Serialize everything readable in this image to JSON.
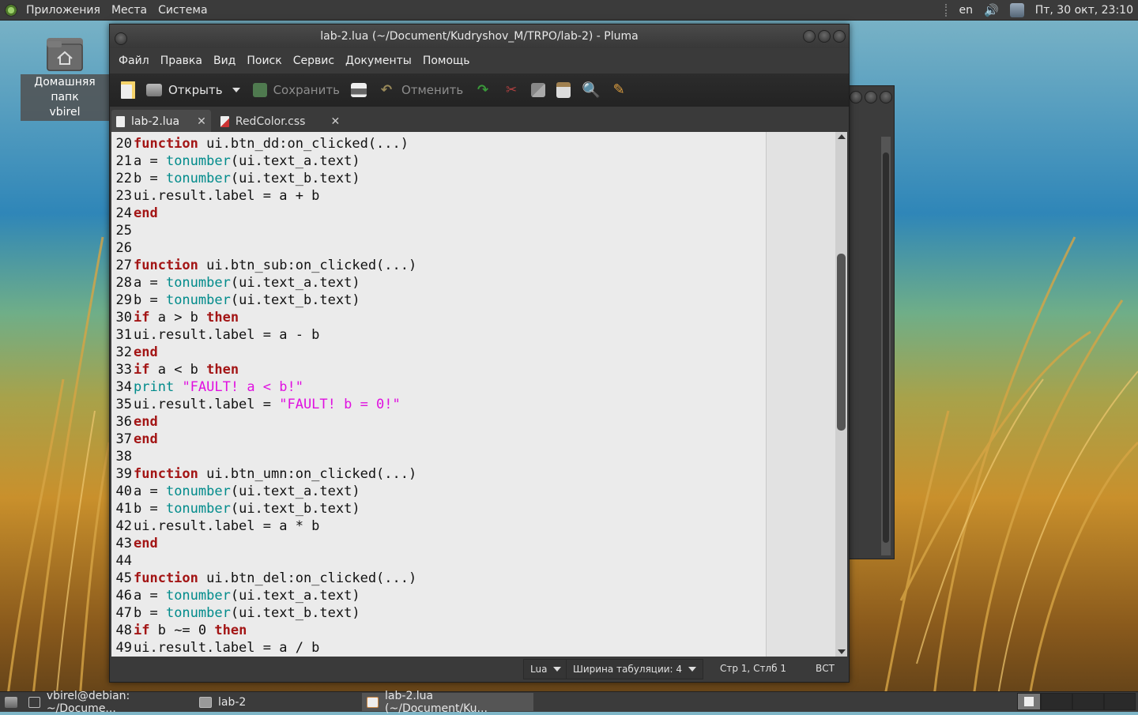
{
  "top_panel": {
    "menus": [
      "Приложения",
      "Места",
      "Система"
    ],
    "keyboard_layout": "en",
    "datetime": "Пт, 30 окт, 23:10"
  },
  "desktop": {
    "home_icon": {
      "line1": "Домашняя папк",
      "line2": "vbirel"
    }
  },
  "window": {
    "title": "lab-2.lua (~/Document/Kudryshov_M/TRPO/lab-2) - Pluma",
    "menu": [
      "Файл",
      "Правка",
      "Вид",
      "Поиск",
      "Сервис",
      "Документы",
      "Помощь"
    ],
    "toolbar": {
      "open": "Открыть",
      "save": "Сохранить",
      "undo": "Отменить"
    },
    "tabs": [
      {
        "label": "lab-2.lua",
        "active": true
      },
      {
        "label": "RedColor.css",
        "active": false
      }
    ],
    "code_lines": [
      {
        "n": "20",
        "tokens": [
          {
            "t": "function",
            "c": "kw"
          },
          {
            "t": " ui.btn_dd:on_clicked(...)",
            "c": ""
          }
        ]
      },
      {
        "n": "21",
        "tokens": [
          {
            "t": "a = ",
            "c": ""
          },
          {
            "t": "tonumber",
            "c": "fn"
          },
          {
            "t": "(ui.text_a.text)",
            "c": ""
          }
        ]
      },
      {
        "n": "22",
        "tokens": [
          {
            "t": "b = ",
            "c": ""
          },
          {
            "t": "tonumber",
            "c": "fn"
          },
          {
            "t": "(ui.text_b.text)",
            "c": ""
          }
        ]
      },
      {
        "n": "23",
        "tokens": [
          {
            "t": "ui.result.label = a + b",
            "c": ""
          }
        ]
      },
      {
        "n": "24",
        "tokens": [
          {
            "t": "end",
            "c": "kw"
          }
        ]
      },
      {
        "n": "25",
        "tokens": []
      },
      {
        "n": "26",
        "tokens": []
      },
      {
        "n": "27",
        "tokens": [
          {
            "t": "function",
            "c": "kw"
          },
          {
            "t": " ui.btn_sub:on_clicked(...)",
            "c": ""
          }
        ]
      },
      {
        "n": "28",
        "tokens": [
          {
            "t": "a = ",
            "c": ""
          },
          {
            "t": "tonumber",
            "c": "fn"
          },
          {
            "t": "(ui.text_a.text)",
            "c": ""
          }
        ]
      },
      {
        "n": "29",
        "tokens": [
          {
            "t": "b = ",
            "c": ""
          },
          {
            "t": "tonumber",
            "c": "fn"
          },
          {
            "t": "(ui.text_b.text)",
            "c": ""
          }
        ]
      },
      {
        "n": "30",
        "tokens": [
          {
            "t": "if",
            "c": "kw"
          },
          {
            "t": " a > b ",
            "c": ""
          },
          {
            "t": "then",
            "c": "kw"
          }
        ]
      },
      {
        "n": "31",
        "tokens": [
          {
            "t": "ui.result.label = a - b",
            "c": ""
          }
        ]
      },
      {
        "n": "32",
        "tokens": [
          {
            "t": "end",
            "c": "kw"
          }
        ]
      },
      {
        "n": "33",
        "tokens": [
          {
            "t": "if",
            "c": "kw"
          },
          {
            "t": " a < b ",
            "c": ""
          },
          {
            "t": "then",
            "c": "kw"
          }
        ]
      },
      {
        "n": "34",
        "tokens": [
          {
            "t": "print",
            "c": "fn"
          },
          {
            "t": " ",
            "c": ""
          },
          {
            "t": "\"FAULT! a < b!\"",
            "c": "str"
          }
        ]
      },
      {
        "n": "35",
        "tokens": [
          {
            "t": "ui.result.label = ",
            "c": ""
          },
          {
            "t": "\"FAULT! b = 0!\"",
            "c": "str"
          }
        ]
      },
      {
        "n": "36",
        "tokens": [
          {
            "t": "end",
            "c": "kw"
          }
        ]
      },
      {
        "n": "37",
        "tokens": [
          {
            "t": "end",
            "c": "kw"
          }
        ]
      },
      {
        "n": "38",
        "tokens": []
      },
      {
        "n": "39",
        "tokens": [
          {
            "t": "function",
            "c": "kw"
          },
          {
            "t": " ui.btn_umn:on_clicked(...)",
            "c": ""
          }
        ]
      },
      {
        "n": "40",
        "tokens": [
          {
            "t": "a = ",
            "c": ""
          },
          {
            "t": "tonumber",
            "c": "fn"
          },
          {
            "t": "(ui.text_a.text)",
            "c": ""
          }
        ]
      },
      {
        "n": "41",
        "tokens": [
          {
            "t": "b = ",
            "c": ""
          },
          {
            "t": "tonumber",
            "c": "fn"
          },
          {
            "t": "(ui.text_b.text)",
            "c": ""
          }
        ]
      },
      {
        "n": "42",
        "tokens": [
          {
            "t": "ui.result.label = a * b",
            "c": ""
          }
        ]
      },
      {
        "n": "43",
        "tokens": [
          {
            "t": "end",
            "c": "kw"
          }
        ]
      },
      {
        "n": "44",
        "tokens": []
      },
      {
        "n": "45",
        "tokens": [
          {
            "t": "function",
            "c": "kw"
          },
          {
            "t": " ui.btn_del:on_clicked(...)",
            "c": ""
          }
        ]
      },
      {
        "n": "46",
        "tokens": [
          {
            "t": "a = ",
            "c": ""
          },
          {
            "t": "tonumber",
            "c": "fn"
          },
          {
            "t": "(ui.text_a.text)",
            "c": ""
          }
        ]
      },
      {
        "n": "47",
        "tokens": [
          {
            "t": "b = ",
            "c": ""
          },
          {
            "t": "tonumber",
            "c": "fn"
          },
          {
            "t": "(ui.text_b.text)",
            "c": ""
          }
        ]
      },
      {
        "n": "48",
        "tokens": [
          {
            "t": "if",
            "c": "kw"
          },
          {
            "t": " b ~= 0 ",
            "c": ""
          },
          {
            "t": "then",
            "c": "kw"
          }
        ]
      },
      {
        "n": "49",
        "tokens": [
          {
            "t": "ui.result.label = a / b",
            "c": ""
          }
        ]
      }
    ],
    "statusbar": {
      "language": "Lua",
      "tab_width": "Ширина табуляции:  4",
      "position": "Стр 1, Стлб 1",
      "mode": "ВСТ"
    }
  },
  "taskbar": {
    "tasks": [
      {
        "label": "vbirel@debian: ~/Docume...",
        "icon": "terminal-icon",
        "active": false
      },
      {
        "label": "lab-2",
        "icon": "folder-icon",
        "active": false
      },
      {
        "label": "lab-2.lua (~/Document/Ku...",
        "icon": "text-editor-icon",
        "active": true
      }
    ]
  },
  "colors": {
    "keyword": "#a31515",
    "builtin": "#008b8b",
    "string": "#e010e0",
    "editor_bg": "#ebebeb"
  }
}
